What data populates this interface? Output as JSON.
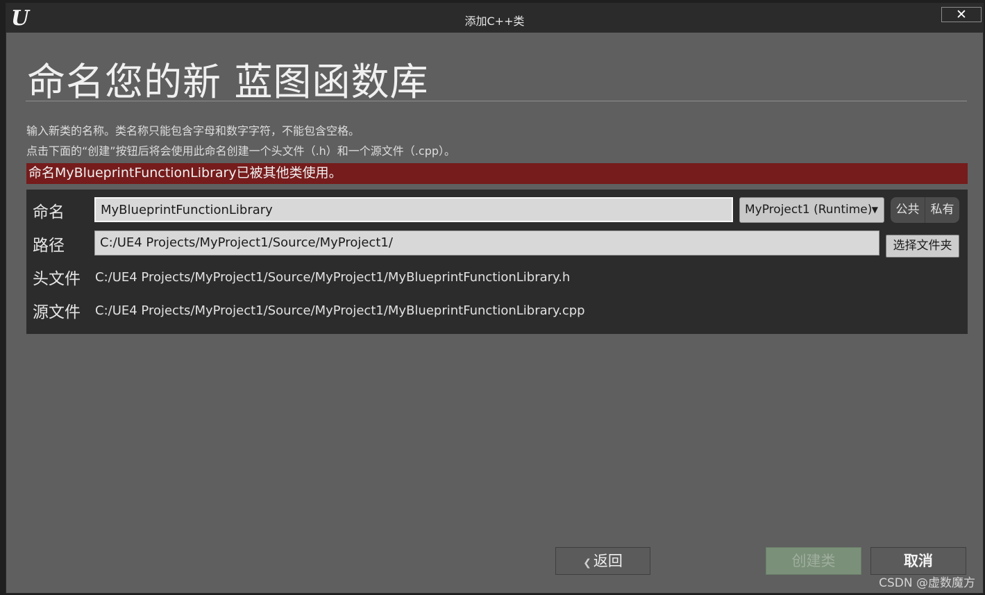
{
  "window": {
    "title": "添加C++类",
    "logo": "U",
    "close_label": "✕"
  },
  "heading": "命名您的新 蓝图函数库",
  "description": {
    "line1": "输入新类的名称。类名称只能包含字母和数字字符，不能包含空格。",
    "line2": "点击下面的“创建”按钮后将会使用此命名创建一个头文件（.h）和一个源文件（.cpp）。"
  },
  "error_message": "命名MyBlueprintFunctionLibrary已被其他类使用。",
  "form": {
    "name_label": "命名",
    "name_value": "MyBlueprintFunctionLibrary",
    "module_select": "MyProject1 (Runtime)",
    "visibility_options": [
      "公共",
      "私有"
    ],
    "path_label": "路径",
    "path_value": "C:/UE4 Projects/MyProject1/Source/MyProject1/",
    "browse_label": "选择文件夹",
    "header_label": "头文件",
    "header_value": "C:/UE4 Projects/MyProject1/Source/MyProject1/MyBlueprintFunctionLibrary.h",
    "source_label": "源文件",
    "source_value": "C:/UE4 Projects/MyProject1/Source/MyProject1/MyBlueprintFunctionLibrary.cpp"
  },
  "footer": {
    "back_label": "返回",
    "create_label": "创建类",
    "cancel_label": "取消"
  },
  "watermark": "CSDN @虚数魔方",
  "colors": {
    "error_bg": "#761c1c",
    "panel_bg": "#2c2c2c",
    "window_bg": "#5f5f5f",
    "create_disabled": "#7a9078"
  },
  "icons": {
    "back": "chevron-left-icon",
    "dropdown": "caret-down-icon"
  }
}
